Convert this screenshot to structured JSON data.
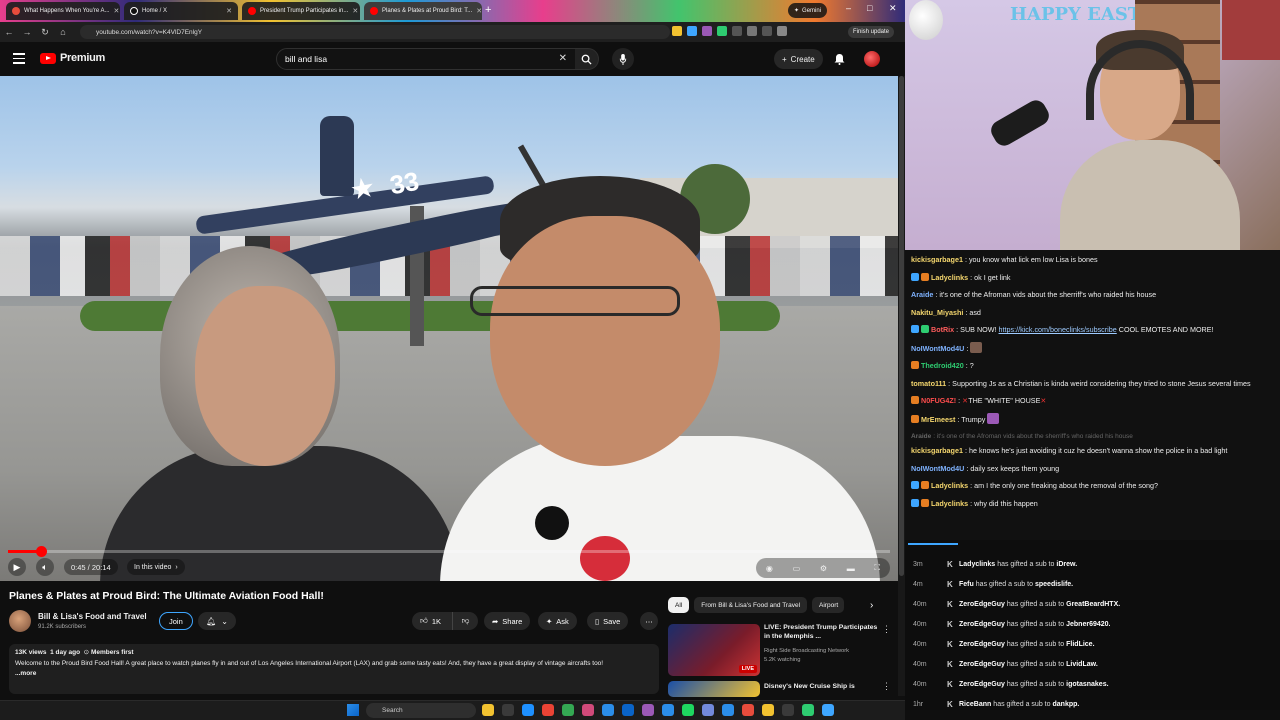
{
  "browser": {
    "tabs": [
      {
        "title": "What Happens When You're A...",
        "color": "#e74c3c"
      },
      {
        "title": "Home / X",
        "color": "#111111"
      },
      {
        "title": "President Trump Participates in...",
        "color": "#ff0000"
      },
      {
        "title": "Planes & Plates at Proud Bird: T...",
        "color": "#ff0000"
      }
    ],
    "gemini_label": "Gemini",
    "url": "youtube.com/watch?v=K4VlD7EnlgY",
    "finish_update": "Finish update"
  },
  "youtube": {
    "logo_text": "Premium",
    "search_value": "bill and lisa",
    "create_label": "Create"
  },
  "player": {
    "time": "0:45 / 20:14",
    "chapter_label": "In this video",
    "progress_fraction": 0.037,
    "plane_number": "33"
  },
  "video": {
    "title": "Planes & Plates at Proud Bird: The Ultimate Aviation Food Hall!",
    "channel": "Bill & Lisa's Food and Travel",
    "subscribers": "91.2K subscribers",
    "join_label": "Join",
    "likes": "1K",
    "share_label": "Share",
    "ask_label": "Ask",
    "save_label": "Save",
    "views": "13K views",
    "age": "1 day ago",
    "members_first": "Members first",
    "description": "Welcome to the Proud Bird Food Hall!  A great place to watch planes fly in and out of Los Angeles International Airport (LAX) and grab some tasty eats!  And, they have a great display of vintage aircrafts too!",
    "more_label": "...more"
  },
  "chips": [
    "All",
    "From Bill & Lisa's Food and Travel",
    "Airport"
  ],
  "recommendations": [
    {
      "title": "LIVE: President Trump Participates in the Memphis ...",
      "channel": "Right Side Broadcasting Network",
      "meta": "5.2K watching",
      "badge": "LIVE"
    },
    {
      "title": "Disney's New Cruise Ship is",
      "channel": "",
      "meta": ""
    }
  ],
  "webcam": {
    "banner": "HAPPY EAST"
  },
  "chat": [
    {
      "user": "kickisgarbage1",
      "color": "#f5d76e",
      "text": "you know what lick em low Lisa is bones",
      "badges": []
    },
    {
      "user": "Ladyclinks",
      "color": "#f5d76e",
      "text": "ok I get link",
      "badges": [
        "#3ea6ff",
        "#e67e22"
      ]
    },
    {
      "user": "Araide",
      "color": "#7fb3ff",
      "text": "it's one of the Afroman vids about the sherriff's who raided his house",
      "badges": []
    },
    {
      "user": "Nakitu_Miyashi",
      "color": "#f5d76e",
      "text": "asd",
      "badges": []
    },
    {
      "user": "BotRix",
      "color": "#ff5c5c",
      "text": "SUB NOW!",
      "link": "https://kick.com/boneclinks/subscribe",
      "after": "COOL EMOTES AND MORE!",
      "badges": [
        "#3ea6ff",
        "#2ecc71"
      ]
    },
    {
      "user": "NoIWontMod4U",
      "color": "#7fb3ff",
      "text": "",
      "badges": [],
      "emote": "#7a5c4e"
    },
    {
      "user": "Thedroid420",
      "color": "#2ecc71",
      "text": "?",
      "badges": [
        "#e67e22"
      ]
    },
    {
      "user": "tomato111",
      "color": "#f5d76e",
      "text": "Supporting Js as a Christian is kinda weird considering they tried to stone Jesus several times",
      "badges": []
    },
    {
      "user": "N0FUG4Z!",
      "color": "#ff4d4d",
      "text": "THE \"WHITE\" HOUSE",
      "badges": [
        "#e67e22"
      ],
      "xwrap": true
    },
    {
      "user": "MrEmeest",
      "color": "#f5d76e",
      "text": "Trumpy",
      "badges": [
        "#e67e22"
      ],
      "emote": "#9b59b6"
    },
    {
      "user": "Araide",
      "color": "#666666",
      "text": "it's one of the Afroman vids about the sherriff's who raided his house",
      "badges": [],
      "dim": true
    },
    {
      "user": "kickisgarbage1",
      "color": "#f5d76e",
      "text": "he knows he's just avoiding it cuz he doesn't wanna show the police in a bad light",
      "badges": []
    },
    {
      "user": "NoIWontMod4U",
      "color": "#7fb3ff",
      "text": "daily sex keeps them young",
      "badges": []
    },
    {
      "user": "Ladyclinks",
      "color": "#f5d76e",
      "text": "am I the only one freaking about the removal of the song?",
      "badges": [
        "#3ea6ff",
        "#e67e22"
      ]
    },
    {
      "user": "Ladyclinks",
      "color": "#f5d76e",
      "text": "why did this happen",
      "badges": [
        "#3ea6ff",
        "#e67e22"
      ]
    }
  ],
  "sub_feed": [
    {
      "time": "3m",
      "gifter": "Ladyclinks",
      "text": "has gifted a sub to",
      "recipient": "iDrew."
    },
    {
      "time": "4m",
      "gifter": "Fefu",
      "text": "has gifted a sub to",
      "recipient": "speedislife."
    },
    {
      "time": "40m",
      "gifter": "ZeroEdgeGuy",
      "text": "has gifted a sub to",
      "recipient": "GreatBeardHTX."
    },
    {
      "time": "40m",
      "gifter": "ZeroEdgeGuy",
      "text": "has gifted a sub to",
      "recipient": "Jebner69420."
    },
    {
      "time": "40m",
      "gifter": "ZeroEdgeGuy",
      "text": "has gifted a sub to",
      "recipient": "FlidLice."
    },
    {
      "time": "40m",
      "gifter": "ZeroEdgeGuy",
      "text": "has gifted a sub to",
      "recipient": "LividLaw."
    },
    {
      "time": "40m",
      "gifter": "ZeroEdgeGuy",
      "text": "has gifted a sub to",
      "recipient": "igotasnakes."
    },
    {
      "time": "1hr",
      "gifter": "RiceBann",
      "text": "has gifted a sub to",
      "recipient": "dankpp."
    }
  ],
  "taskbar": {
    "search_placeholder": "Search",
    "icon_colors": [
      "#f2c230",
      "#3a3a3a",
      "#1e90ff",
      "#ea4335",
      "#34a853",
      "#d04a7a",
      "#2b8de8",
      "#0a64c8",
      "#9b59b6",
      "#2b8de8",
      "#1ed760",
      "#7289da",
      "#2b8de8",
      "#e74c3c",
      "#f2c230",
      "#3a3a3a",
      "#2ecc71",
      "#3ea6ff"
    ]
  }
}
